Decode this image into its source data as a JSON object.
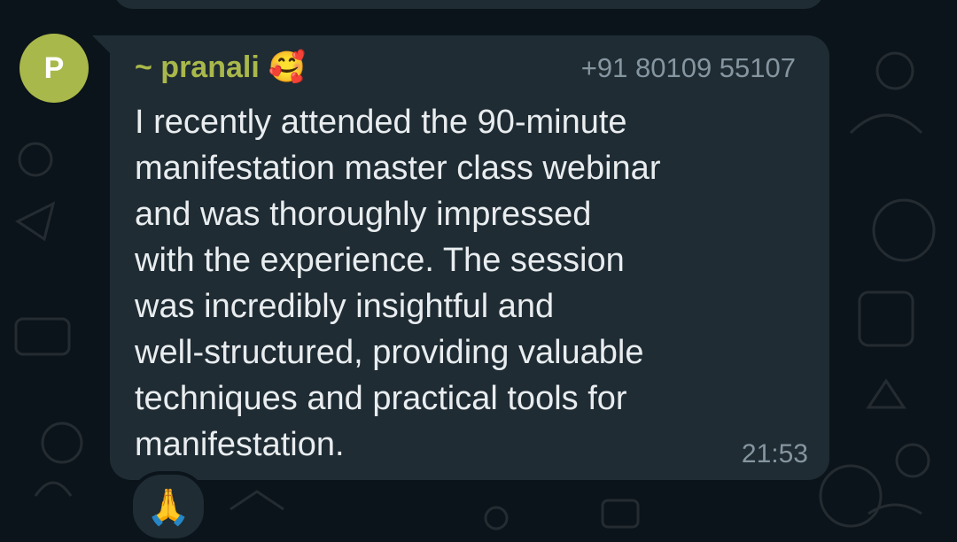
{
  "chat": {
    "avatar_letter": "P",
    "sender_name": "~ pranali",
    "sender_emoji": "🥰",
    "sender_phone": "+91 80109 55107",
    "message_text": "I recently attended the 90-minute\nmanifestation master class webinar\nand was thoroughly impressed\nwith the experience. The session\nwas incredibly insightful and\nwell-structured, providing valuable\ntechniques and practical tools for\nmanifestation.",
    "timestamp": "21:53",
    "reaction": "🙏"
  },
  "colors": {
    "background": "#0b141a",
    "bubble": "#1f2c34",
    "sender_name": "#a9b84a",
    "avatar": "#a9b84a",
    "meta_text": "#8696a0",
    "message_text": "#e9edef"
  },
  "icons": {
    "reaction_icon": "folded-hands-icon",
    "sender_emoji_icon": "smiling-face-with-hearts-icon"
  }
}
